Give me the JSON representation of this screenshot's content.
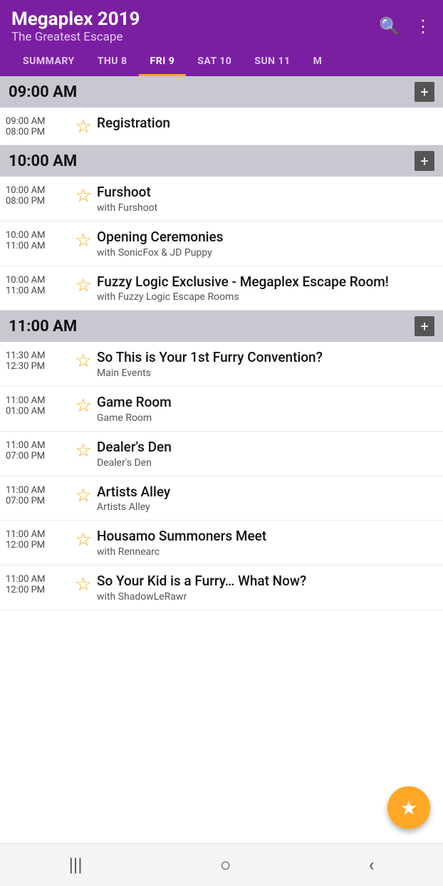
{
  "header": {
    "title": "Megaplex 2019",
    "subtitle": "The Greatest Escape",
    "search_icon": "🔍",
    "menu_icon": "⋮"
  },
  "tabs": [
    {
      "label": "SUMMARY",
      "active": false
    },
    {
      "label": "THU 8",
      "active": false
    },
    {
      "label": "FRI 9",
      "active": true
    },
    {
      "label": "SAT 10",
      "active": false
    },
    {
      "label": "SUN 11",
      "active": false
    },
    {
      "label": "M",
      "active": false
    }
  ],
  "sections": [
    {
      "time": "09:00 AM",
      "events": [
        {
          "start": "09:00 AM",
          "end": "08:00 PM",
          "title": "Registration",
          "subtitle": ""
        }
      ]
    },
    {
      "time": "10:00 AM",
      "events": [
        {
          "start": "10:00 AM",
          "end": "08:00 PM",
          "title": "Furshoot",
          "subtitle": "with Furshoot"
        },
        {
          "start": "10:00 AM",
          "end": "11:00 AM",
          "title": "Opening Ceremonies",
          "subtitle": "with SonicFox & JD Puppy"
        },
        {
          "start": "10:00 AM",
          "end": "11:00 AM",
          "title": "Fuzzy Logic Exclusive - Megaplex Escape Room!",
          "subtitle": "with Fuzzy Logic Escape Rooms"
        }
      ]
    },
    {
      "time": "11:00 AM",
      "events": [
        {
          "start": "11:30 AM",
          "end": "12:30 PM",
          "title": "So This is Your 1st Furry Convention?",
          "subtitle": "Main Events"
        },
        {
          "start": "11:00 AM",
          "end": "01:00 AM",
          "title": "Game Room",
          "subtitle": "Game Room"
        },
        {
          "start": "11:00 AM",
          "end": "07:00 PM",
          "title": "Dealer's Den",
          "subtitle": "Dealer's Den"
        },
        {
          "start": "11:00 AM",
          "end": "07:00 PM",
          "title": "Artists Alley",
          "subtitle": "Artists Alley"
        },
        {
          "start": "11:00 AM",
          "end": "12:00 PM",
          "title": "Housamo Summoners Meet",
          "subtitle": "with Rennearc"
        },
        {
          "start": "11:00 AM",
          "end": "12:00 PM",
          "title": "So Your Kid is a Furry… What Now?",
          "subtitle": "with ShadowLeRawr"
        }
      ]
    }
  ],
  "fab": {
    "icon": "★"
  },
  "bottom_nav": {
    "icons": [
      "|||",
      "○",
      "<"
    ]
  }
}
